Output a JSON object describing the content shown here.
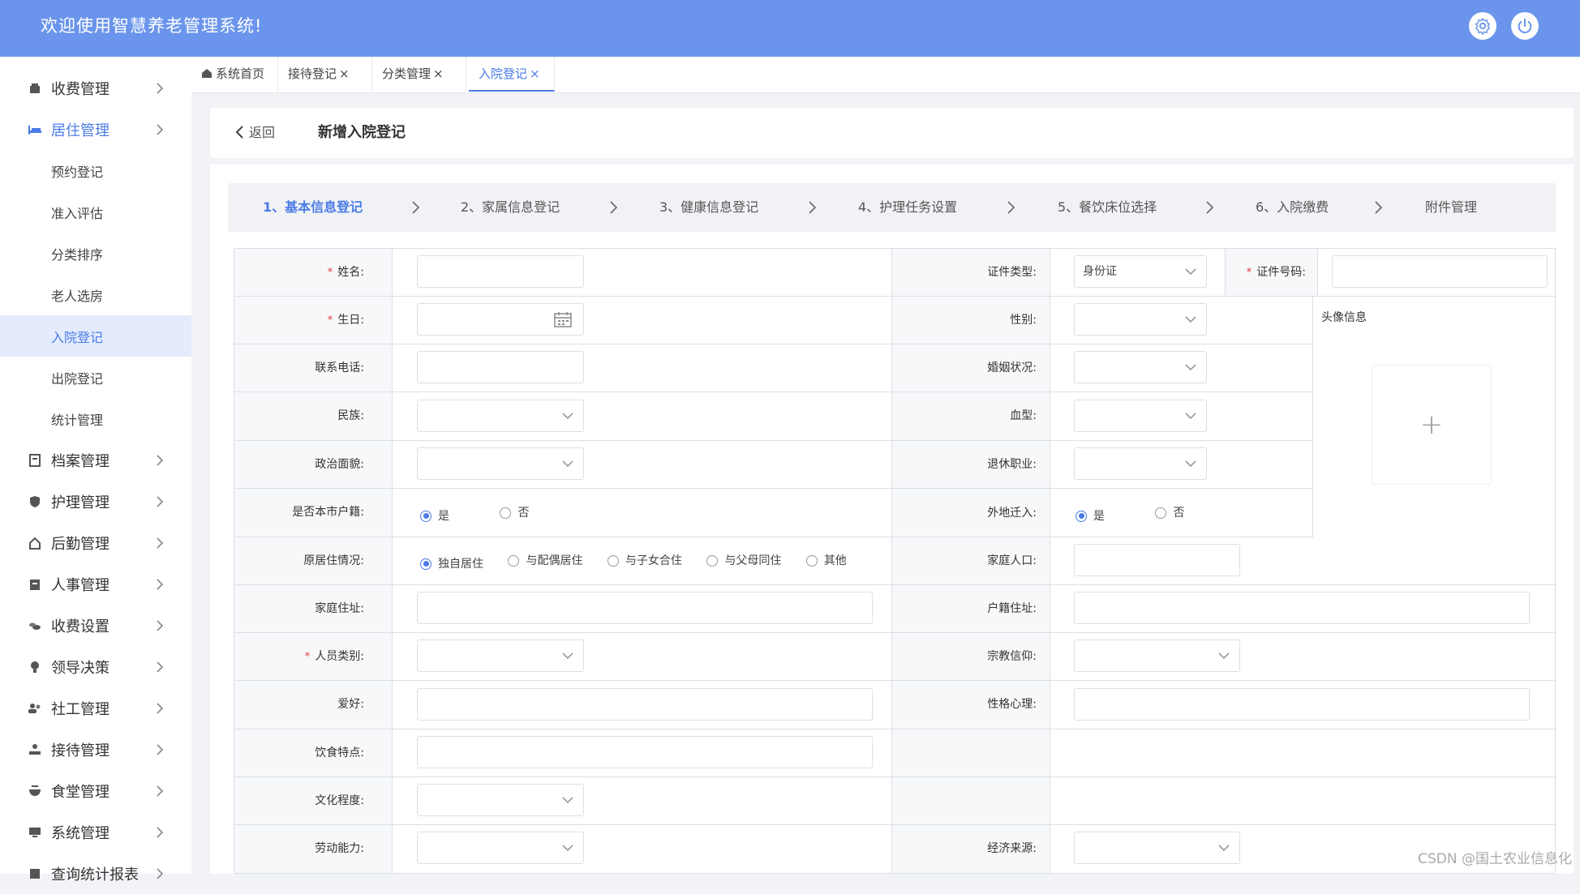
{
  "header": {
    "title": "欢迎使用智慧养老管理系统!"
  },
  "sidebar": {
    "items": [
      {
        "label": "收费管理"
      },
      {
        "label": "居住管理"
      },
      {
        "label": "档案管理"
      },
      {
        "label": "护理管理"
      },
      {
        "label": "后勤管理"
      },
      {
        "label": "人事管理"
      },
      {
        "label": "收费设置"
      },
      {
        "label": "领导决策"
      },
      {
        "label": "社工管理"
      },
      {
        "label": "接待管理"
      },
      {
        "label": "食堂管理"
      },
      {
        "label": "系统管理"
      },
      {
        "label": "查询统计报表"
      }
    ],
    "sub_items": [
      {
        "label": "预约登记"
      },
      {
        "label": "准入评估"
      },
      {
        "label": "分类排序"
      },
      {
        "label": "老人选房"
      },
      {
        "label": "入院登记"
      },
      {
        "label": "出院登记"
      },
      {
        "label": "统计管理"
      }
    ]
  },
  "tabs": [
    {
      "label": "系统首页"
    },
    {
      "label": "接待登记"
    },
    {
      "label": "分类管理"
    },
    {
      "label": "入院登记"
    }
  ],
  "tab_close": "×",
  "page": {
    "back": "返回",
    "title": "新增入院登记"
  },
  "steps": [
    {
      "label": "1、基本信息登记"
    },
    {
      "label": "2、家属信息登记"
    },
    {
      "label": "3、健康信息登记"
    },
    {
      "label": "4、护理任务设置"
    },
    {
      "label": "5、餐饮床位选择"
    },
    {
      "label": "6、入院缴费"
    },
    {
      "label": "附件管理"
    }
  ],
  "form": {
    "required_mark": "*",
    "name": "姓名:",
    "id_type": "证件类型:",
    "id_type_value": "身份证",
    "id_number": "证件号码:",
    "birthday": "生日:",
    "gender": "性别:",
    "avatar": "头像信息",
    "avatar_plus": "+",
    "phone": "联系电话:",
    "marital": "婚姻状况:",
    "ethnicity": "民族:",
    "blood": "血型:",
    "political": "政治面貌:",
    "retire_job": "退休职业:",
    "local_hukou": "是否本市户籍:",
    "migrated": "外地迁入:",
    "yes": "是",
    "no": "否",
    "living": "原居住情况:",
    "living_options": [
      "独自居住",
      "与配偶居住",
      "与子女合住",
      "与父母同住",
      "其他"
    ],
    "family_size": "家庭人口:",
    "home_address": "家庭住址:",
    "hukou_address": "户籍住址:",
    "person_type": "人员类别:",
    "religion": "宗教信仰:",
    "hobby": "爱好:",
    "personality": "性格心理:",
    "diet": "饮食特点:",
    "education": "文化程度:",
    "labor": "劳动能力:",
    "income": "经济来源:"
  },
  "watermark": "CSDN @国土农业信息化",
  "colors": {
    "topbar": "#6b95ec",
    "accent": "#4a7be6",
    "required": "#e23a3a"
  }
}
